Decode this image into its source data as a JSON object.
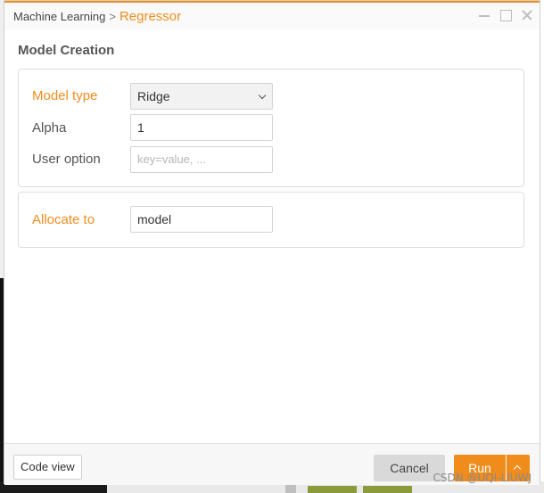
{
  "titlebar": {
    "breadcrumb_parent": "Machine Learning",
    "separator": ">",
    "breadcrumb_current": "Regressor"
  },
  "section": {
    "title": "Model Creation"
  },
  "form": {
    "model_type_label": "Model type",
    "model_type_value": "Ridge",
    "alpha_label": "Alpha",
    "alpha_value": "1",
    "user_option_label": "User option",
    "user_option_placeholder": "key=value, ...",
    "allocate_label": "Allocate to",
    "allocate_value": "model"
  },
  "footer": {
    "code_view_label": "Code view",
    "cancel_label": "Cancel",
    "run_label": "Run"
  },
  "watermark": "CSDN @UQI-LIUWJ",
  "colors": {
    "accent": "#f08c1c",
    "text": "#555555"
  }
}
